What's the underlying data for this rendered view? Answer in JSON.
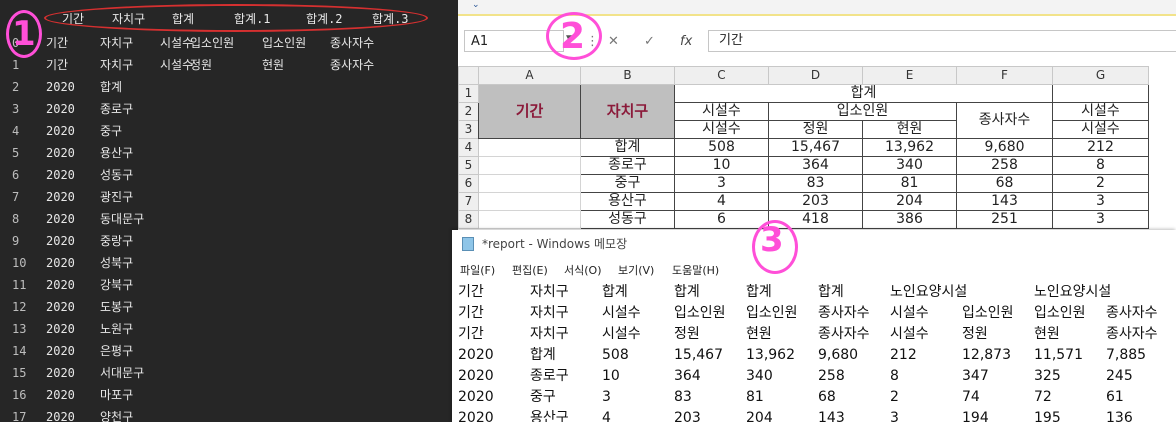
{
  "terminal": {
    "header": [
      "기간",
      "자치구",
      "합계",
      "합계.1",
      "합계.2",
      "합계.3"
    ],
    "rows": [
      [
        "0",
        "기간",
        "자치구",
        "시설수",
        "입소인원",
        "입소인원",
        "종사자수"
      ],
      [
        "1",
        "기간",
        "자치구",
        "시설수",
        "정원",
        "현원",
        "종사자수"
      ],
      [
        "2",
        "2020",
        "합계",
        "508",
        "15,467",
        "13,962",
        "9,680"
      ],
      [
        "3",
        "2020",
        "종로구",
        "10",
        "364",
        "340",
        "258"
      ],
      [
        "4",
        "2020",
        "중구",
        "3",
        "83",
        "81",
        "68"
      ],
      [
        "5",
        "2020",
        "용산구",
        "4",
        "203",
        "204",
        "143"
      ],
      [
        "6",
        "2020",
        "성동구",
        "6",
        "418",
        "386",
        "251"
      ],
      [
        "7",
        "2020",
        "광진구",
        "20",
        "595",
        "556",
        "368"
      ],
      [
        "8",
        "2020",
        "동대문구",
        "25",
        "408",
        "386",
        "264"
      ],
      [
        "9",
        "2020",
        "중랑구",
        "48",
        "1,201",
        "1,097",
        "740"
      ],
      [
        "10",
        "2020",
        "성북구",
        "21",
        "757",
        "651",
        "431"
      ],
      [
        "11",
        "2020",
        "강북구",
        "31",
        "707",
        "676",
        "462"
      ],
      [
        "12",
        "2020",
        "도봉구",
        "55",
        "1,144",
        "1,058",
        "725"
      ],
      [
        "13",
        "2020",
        "노원구",
        "32",
        "1,069",
        "963",
        "661"
      ],
      [
        "14",
        "2020",
        "은평구",
        "22",
        "1,132",
        "1,045",
        "683"
      ],
      [
        "15",
        "2020",
        "서대문구",
        "18",
        "453",
        "387",
        "292"
      ],
      [
        "16",
        "2020",
        "마포구",
        "4",
        "302",
        "298",
        "213"
      ],
      [
        "17",
        "2020",
        "양천구",
        "21",
        "723",
        "684",
        "485"
      ]
    ]
  },
  "annotations": {
    "one": "1",
    "two": "2",
    "three": "3"
  },
  "excel": {
    "name_box": "A1",
    "formula_icons": {
      "cancel": "✕",
      "confirm": "✓",
      "fx": "fx"
    },
    "formula_value": "기간",
    "columns": [
      "",
      "A",
      "B",
      "C",
      "D",
      "E",
      "F",
      "G"
    ],
    "row_numbers": [
      "1",
      "2",
      "3",
      "4",
      "5",
      "6",
      "7",
      "8"
    ],
    "key_a": "기간",
    "key_b": "자치구",
    "r1_c_to_f": "합계",
    "r2": {
      "c": "시설수",
      "de": "입소인원",
      "f": "종사자수",
      "g": "시설수"
    },
    "r3": {
      "c": "시설수",
      "d": "정원",
      "e": "현원",
      "g": "시설수"
    },
    "data": [
      [
        "합계",
        "508",
        "15,467",
        "13,962",
        "9,680",
        "212"
      ],
      [
        "종로구",
        "10",
        "364",
        "340",
        "258",
        "8"
      ],
      [
        "중구",
        "3",
        "83",
        "81",
        "68",
        "2"
      ],
      [
        "용산구",
        "4",
        "203",
        "204",
        "143",
        "3"
      ],
      [
        "성동구",
        "6",
        "418",
        "386",
        "251",
        "3"
      ]
    ]
  },
  "notepad": {
    "title": "*report - Windows 메모장",
    "menu": [
      "파일(F)",
      "편집(E)",
      "서식(O)",
      "보기(V)",
      "도움말(H)"
    ],
    "rows": [
      [
        "기간",
        "자치구",
        "합계",
        "합계",
        "합계",
        "합계",
        "노인요양시설",
        "노인요양시설"
      ],
      [
        "기간",
        "자치구",
        "시설수",
        "입소인원",
        "입소인원",
        "종사자수",
        "시설수",
        "입소인원",
        "입소인원",
        "종사자수"
      ],
      [
        "기간",
        "자치구",
        "시설수",
        "정원",
        "현원",
        "종사자수",
        "시설수",
        "정원",
        "현원",
        "종사자수"
      ],
      [
        "2020",
        "합계",
        "508",
        "15,467",
        "13,962",
        "9,680",
        "212",
        "12,873",
        "11,571",
        "7,885"
      ],
      [
        "2020",
        "종로구",
        "10",
        "364",
        "340",
        "258",
        "8",
        "347",
        "325",
        "245"
      ],
      [
        "2020",
        "중구",
        "3",
        "83",
        "81",
        "68",
        "2",
        "74",
        "72",
        "61"
      ],
      [
        "2020",
        "용산구",
        "4",
        "203",
        "204",
        "143",
        "3",
        "194",
        "195",
        "136"
      ]
    ]
  }
}
